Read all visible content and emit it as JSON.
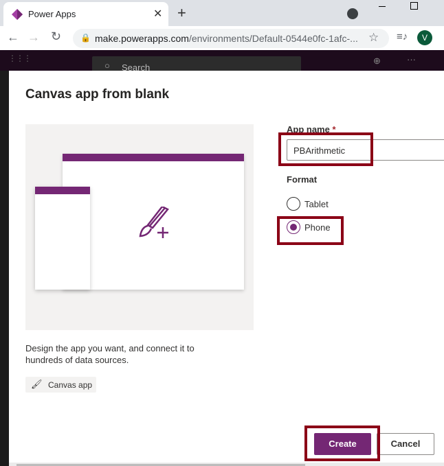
{
  "browser": {
    "tab_title": "Power Apps",
    "url_domain": "make.powerapps.com",
    "url_path": "/environments/Default-0544e0fc-1afc-...",
    "profile_initial": "V"
  },
  "app_header": {
    "search_placeholder": "Search"
  },
  "dialog": {
    "title": "Canvas app from blank",
    "description": "Design the app you want, and connect it to hundreds of data sources.",
    "chip_label": "Canvas app",
    "app_name_label": "App name",
    "required_marker": "*",
    "app_name_value": "PBArithmetic",
    "format_label": "Format",
    "format_options": [
      {
        "label": "Tablet",
        "selected": false
      },
      {
        "label": "Phone",
        "selected": true
      }
    ],
    "create_label": "Create",
    "cancel_label": "Cancel"
  },
  "colors": {
    "accent": "#742774",
    "highlight": "#8b0016"
  }
}
